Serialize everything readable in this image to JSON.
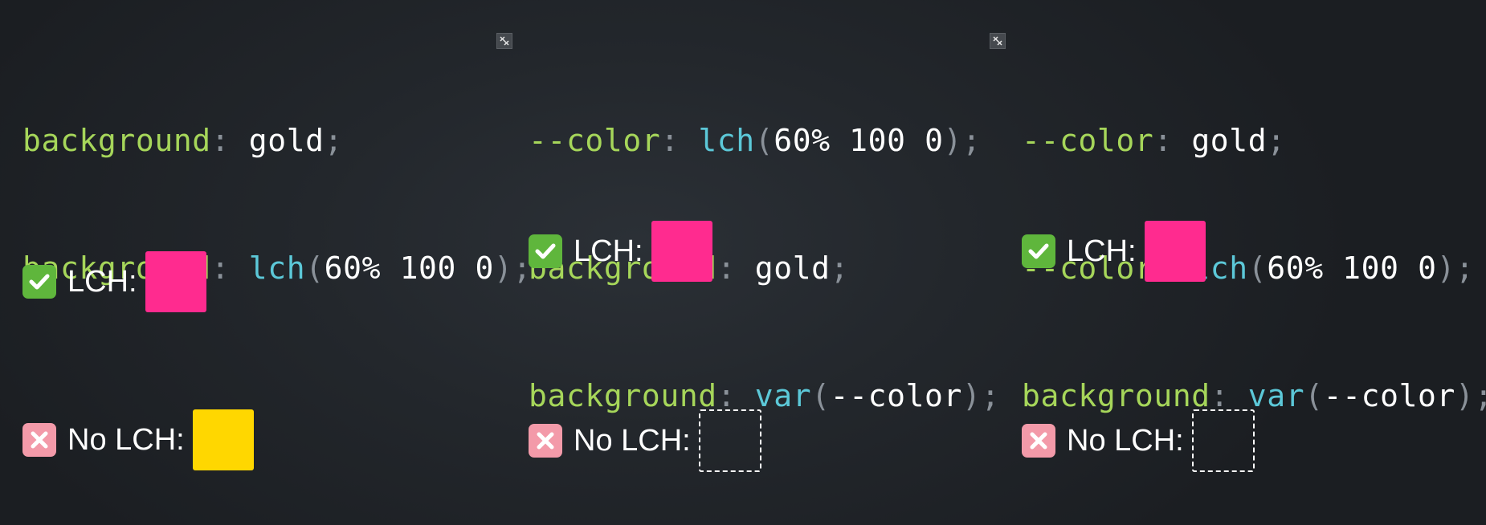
{
  "columns": [
    {
      "code_lines": [
        [
          {
            "cls": "prop",
            "text": "background"
          },
          {
            "cls": "colon",
            "text": ": "
          },
          {
            "cls": "val",
            "text": "gold"
          },
          {
            "cls": "punc",
            "text": ";"
          }
        ],
        [
          {
            "cls": "prop",
            "text": "background"
          },
          {
            "cls": "colon",
            "text": ": "
          },
          {
            "cls": "fn",
            "text": "lch"
          },
          {
            "cls": "punc",
            "text": "("
          },
          {
            "cls": "val",
            "text": "60% 100 0"
          },
          {
            "cls": "punc",
            "text": ");"
          }
        ]
      ],
      "lch": {
        "label": "LCH:",
        "swatch_color": "#ff2b8f",
        "emoji": "check-mark-button-icon"
      },
      "no_lch": {
        "label": "No LCH:",
        "swatch_color": "#ffd700",
        "emoji": "cross-mark-icon",
        "swatch_empty": false
      }
    },
    {
      "code_lines": [
        [
          {
            "cls": "prop",
            "text": "--color"
          },
          {
            "cls": "colon",
            "text": ": "
          },
          {
            "cls": "fn",
            "text": "lch"
          },
          {
            "cls": "punc",
            "text": "("
          },
          {
            "cls": "val",
            "text": "60% 100 0"
          },
          {
            "cls": "punc",
            "text": ");"
          }
        ],
        [
          {
            "cls": "prop",
            "text": "background"
          },
          {
            "cls": "colon",
            "text": ": "
          },
          {
            "cls": "val",
            "text": "gold"
          },
          {
            "cls": "punc",
            "text": ";"
          }
        ],
        [
          {
            "cls": "prop",
            "text": "background"
          },
          {
            "cls": "colon",
            "text": ": "
          },
          {
            "cls": "fn",
            "text": "var"
          },
          {
            "cls": "punc",
            "text": "("
          },
          {
            "cls": "val",
            "text": "--color"
          },
          {
            "cls": "punc",
            "text": ");"
          }
        ]
      ],
      "lch": {
        "label": "LCH:",
        "swatch_color": "#ff2b8f",
        "emoji": "check-mark-button-icon"
      },
      "no_lch": {
        "label": "No LCH:",
        "swatch_color": "transparent",
        "emoji": "cross-mark-icon",
        "swatch_empty": true
      }
    },
    {
      "code_lines": [
        [
          {
            "cls": "prop",
            "text": "--color"
          },
          {
            "cls": "colon",
            "text": ": "
          },
          {
            "cls": "val",
            "text": "gold"
          },
          {
            "cls": "punc",
            "text": ";"
          }
        ],
        [
          {
            "cls": "prop",
            "text": "--color"
          },
          {
            "cls": "colon",
            "text": ": "
          },
          {
            "cls": "fn",
            "text": "lch"
          },
          {
            "cls": "punc",
            "text": "("
          },
          {
            "cls": "val",
            "text": "60% 100 0"
          },
          {
            "cls": "punc",
            "text": ");"
          }
        ],
        [
          {
            "cls": "prop",
            "text": "background"
          },
          {
            "cls": "colon",
            "text": ": "
          },
          {
            "cls": "fn",
            "text": "var"
          },
          {
            "cls": "punc",
            "text": "("
          },
          {
            "cls": "val",
            "text": "--color"
          },
          {
            "cls": "punc",
            "text": ");"
          }
        ]
      ],
      "lch": {
        "label": "LCH:",
        "swatch_color": "#ff2b8f",
        "emoji": "check-mark-button-icon"
      },
      "no_lch": {
        "label": "No LCH:",
        "swatch_color": "transparent",
        "emoji": "cross-mark-icon",
        "swatch_empty": true
      }
    }
  ],
  "colors": {
    "property": "#a6d65a",
    "function": "#5cc8d8",
    "value": "#ffffff",
    "punctuation": "#8a9199",
    "lch_pink": "#ff2b8f",
    "gold": "#ffd700"
  },
  "icons": {
    "editor_toggle": "edit-toggle-icon",
    "check": "check-mark-button-icon",
    "cross": "cross-mark-icon"
  }
}
